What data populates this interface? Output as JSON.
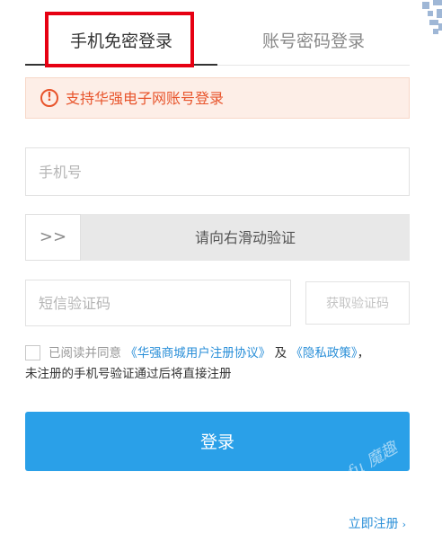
{
  "tabs": {
    "sms_login": "手机免密登录",
    "password_login": "账号密码登录"
  },
  "alert": {
    "icon": "!",
    "text": "支持华强电子网账号登录"
  },
  "phone": {
    "placeholder": "手机号"
  },
  "slider": {
    "handle_icon": ">>",
    "text": "请向右滑动验证"
  },
  "sms": {
    "placeholder": "短信验证码",
    "get_code_label": "获取验证码"
  },
  "agreement": {
    "prefix": "已阅读并同意",
    "user_agreement": "《华强商城用户注册协议》",
    "and": "及",
    "privacy_policy": "《隐私政策》",
    "comma": "，",
    "note": "未注册的手机号验证通过后将直接注册"
  },
  "login_label": "登录",
  "register": {
    "label": "立即注册",
    "arrow": "›"
  },
  "watermark": "mfu 魔趣",
  "colors": {
    "accent_blue": "#2aa0e8",
    "link_blue": "#2a8fd8",
    "alert_orange": "#e8542b",
    "highlight_red": "#e60012"
  }
}
